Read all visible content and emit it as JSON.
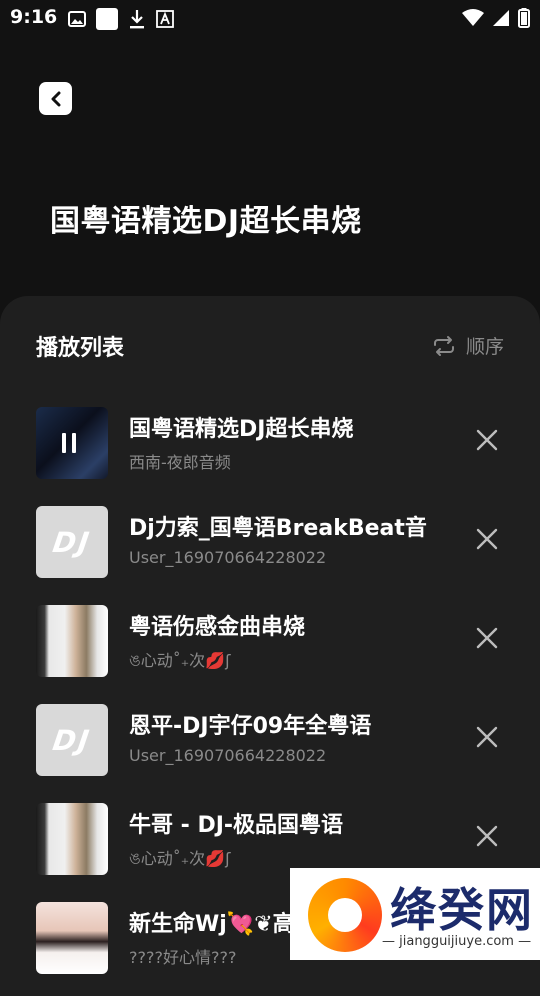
{
  "status_bar": {
    "time": "9:16"
  },
  "header": {
    "title": "国粤语精选DJ超长串烧"
  },
  "playlist": {
    "title": "播放列表",
    "mode_label": "顺序",
    "items": [
      {
        "song": " 国粤语精选DJ超长串烧",
        "artist": "西南-夜郎音频",
        "thumb": "dark",
        "playing": true
      },
      {
        "song": "Dj力索_国粤语BreakBeat音",
        "artist": "User_169070664228022",
        "thumb": "dj"
      },
      {
        "song": "粤语伤感金曲串烧",
        "artist": "ঙ心动˚₊次💋ʃ",
        "thumb": "girl"
      },
      {
        "song": "恩平-DJ宇仔09年全粤语",
        "artist": "User_169070664228022",
        "thumb": "dj"
      },
      {
        "song": "牛哥 - DJ-极品国粤语",
        "artist": "ঙ心动˚₊次💋ʃ",
        "thumb": "girl"
      },
      {
        "song": "新生命Wj💘❦高",
        "artist": "????好心情???",
        "thumb": "girl2"
      }
    ],
    "dj_logo_text": "DJ"
  },
  "watermark": {
    "name": "绛癸网",
    "url": "— jiangguijiuye.com —"
  }
}
